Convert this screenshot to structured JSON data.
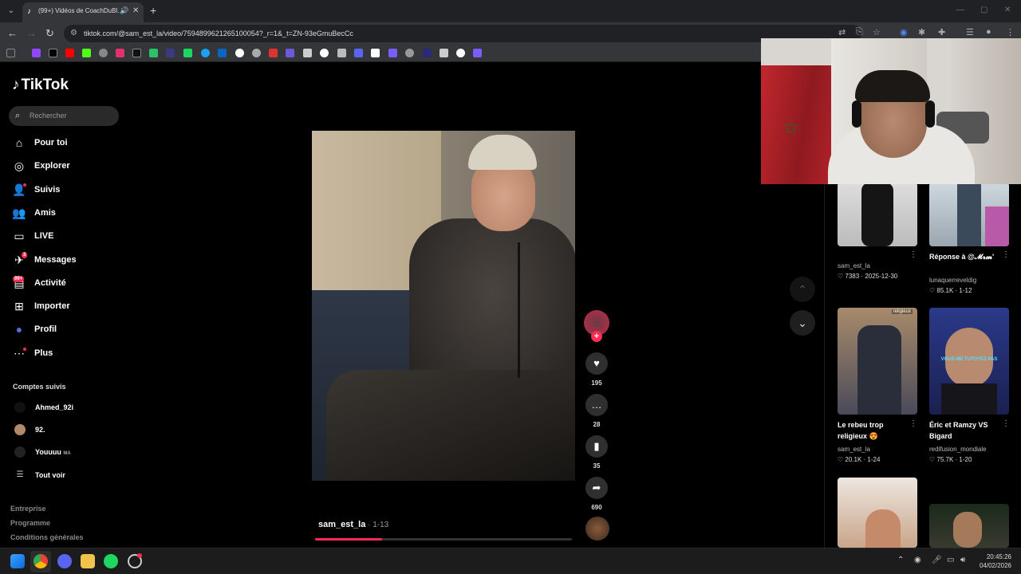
{
  "browser": {
    "tab_title": "(99+) Vidéos de CoachDuBl…",
    "url": "tiktok.com/@sam_est_la/video/7594899621265100054?_r=1&_t=ZN-93eGmuBecCc",
    "window_controls": [
      "—",
      "▢",
      "✕"
    ]
  },
  "sidebar": {
    "brand": "TikTok",
    "search_placeholder": "Rechercher",
    "nav": [
      {
        "label": "Pour toi",
        "icon": "home-icon"
      },
      {
        "label": "Explorer",
        "icon": "compass-icon"
      },
      {
        "label": "Suivis",
        "icon": "following-icon"
      },
      {
        "label": "Amis",
        "icon": "friends-icon"
      },
      {
        "label": "LIVE",
        "icon": "live-icon"
      },
      {
        "label": "Messages",
        "icon": "messages-icon",
        "badge": "3"
      },
      {
        "label": "Activité",
        "icon": "activity-icon",
        "badge": "99+"
      },
      {
        "label": "Importer",
        "icon": "upload-icon"
      },
      {
        "label": "Profil",
        "icon": "profile-icon"
      },
      {
        "label": "Plus",
        "icon": "more-icon"
      }
    ],
    "following_title": "Comptes suivis",
    "following": [
      {
        "name": "Ahmed_92i"
      },
      {
        "name": "92."
      },
      {
        "name": "Youuuu",
        "suffix": "MA"
      },
      {
        "name": "Tout voir"
      }
    ],
    "footer": [
      "Entreprise",
      "Programme",
      "Conditions générales"
    ]
  },
  "video": {
    "author": "sam_est_la",
    "date": " · 1-13",
    "progress": 0.26,
    "likes": "195",
    "comments": "28",
    "saves": "35",
    "shares": "690"
  },
  "related": [
    {
      "title": "",
      "author": "sam_est_la",
      "likes": "7383",
      "date": "2025-12-30"
    },
    {
      "title": "Réponse à @𝓜𝓻𝓶'",
      "author": "lunaquerreveldig",
      "likes": "85.1K",
      "date": "1-12"
    },
    {
      "title": "Le rebeu trop religieux 😍",
      "author": "sam_est_la",
      "likes": "20.1K",
      "date": "1-24",
      "thumb_tag": "religieux"
    },
    {
      "title": "Éric et Ramzy VS Bigard",
      "author": "redifusion_mondiale",
      "likes": "75.7K",
      "date": "1-20",
      "thumb_caption": "VOUS ME TUTOYEZ PAS"
    }
  ],
  "taskbar": {
    "time": "20:45:26",
    "date": "04/02/2026"
  },
  "colors": {
    "accent": "#fe2c55",
    "background": "#000000",
    "chrome_dark": "#202124",
    "chrome_mid": "#35363a"
  }
}
